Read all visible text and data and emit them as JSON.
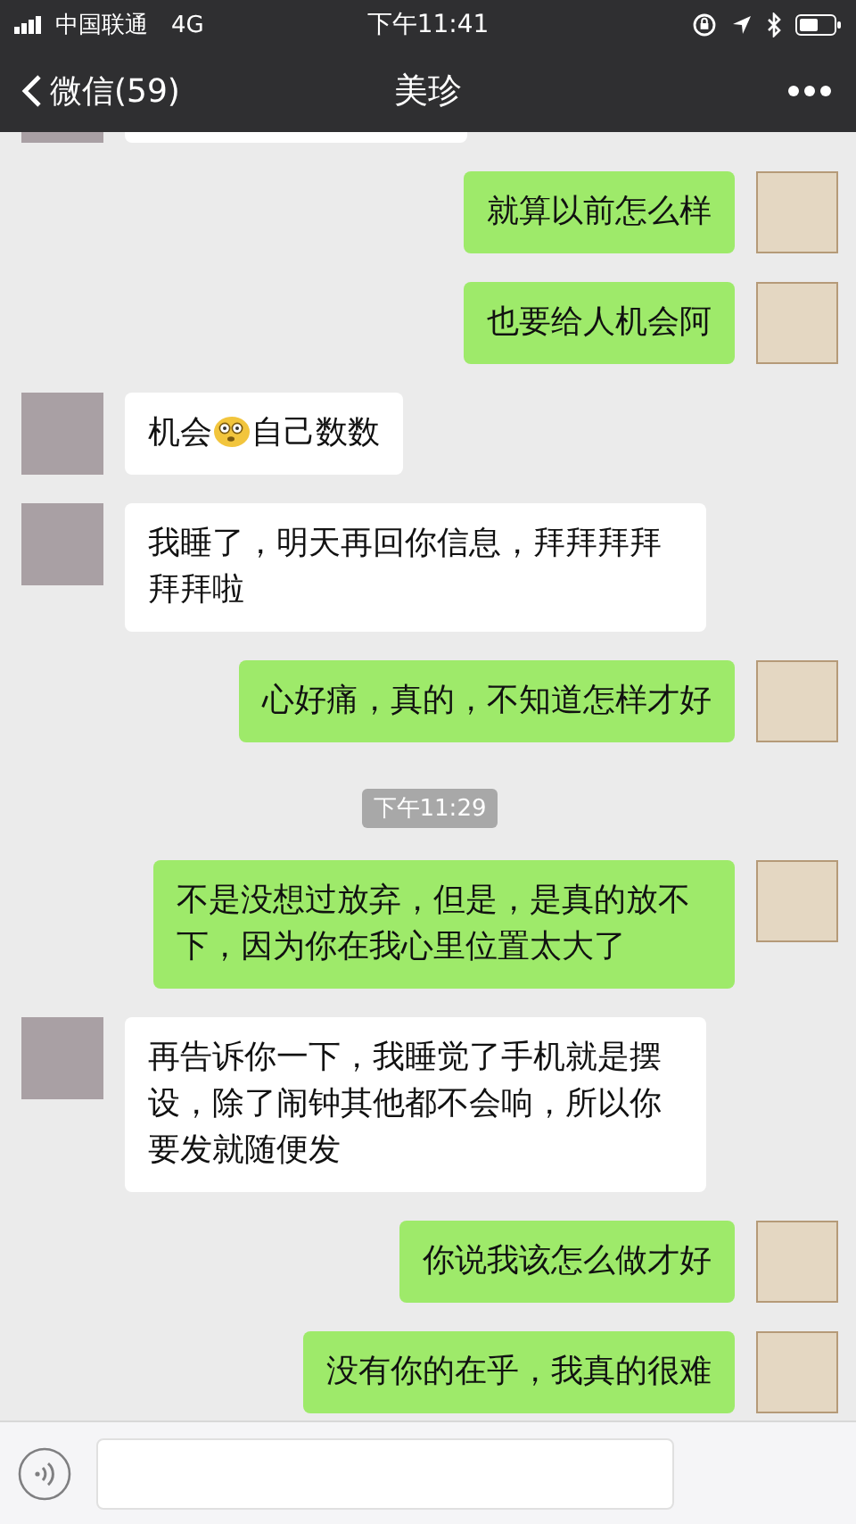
{
  "status_bar": {
    "carrier": "中国联通",
    "network": "4G",
    "time": "下午11:41"
  },
  "nav": {
    "back_label": "微信(59)",
    "title": "美珍"
  },
  "messages": [
    {
      "kind": "partial",
      "sent": false
    },
    {
      "kind": "message",
      "sent": true,
      "segments": [
        {
          "kind": "text",
          "text": "就算以前怎么样"
        }
      ]
    },
    {
      "kind": "message",
      "sent": true,
      "segments": [
        {
          "kind": "text",
          "text": "也要给人机会阿"
        }
      ]
    },
    {
      "kind": "message",
      "sent": false,
      "segments": [
        {
          "kind": "text",
          "text": "机会"
        },
        {
          "kind": "emoji"
        },
        {
          "kind": "text",
          "text": "自己数数"
        }
      ]
    },
    {
      "kind": "message",
      "sent": false,
      "segments": [
        {
          "kind": "text",
          "text": "我睡了，明天再回你信息，拜拜拜拜拜拜啦"
        }
      ]
    },
    {
      "kind": "message",
      "sent": true,
      "segments": [
        {
          "kind": "text",
          "text": "心好痛，真的，不知道怎样才好"
        }
      ]
    },
    {
      "kind": "time",
      "text": "下午11:29"
    },
    {
      "kind": "message",
      "sent": true,
      "segments": [
        {
          "kind": "text",
          "text": "不是没想过放弃，但是，是真的放不下，因为你在我心里位置太大了"
        }
      ]
    },
    {
      "kind": "message",
      "sent": false,
      "segments": [
        {
          "kind": "text",
          "text": "再告诉你一下，我睡觉了手机就是摆设，除了闹钟其他都不会响，所以你要发就随便发"
        }
      ]
    },
    {
      "kind": "message",
      "sent": true,
      "segments": [
        {
          "kind": "text",
          "text": "你说我该怎么做才好"
        }
      ]
    },
    {
      "kind": "message",
      "sent": true,
      "segments": [
        {
          "kind": "text",
          "text": "没有你的在乎，我真的很难"
        }
      ]
    }
  ]
}
